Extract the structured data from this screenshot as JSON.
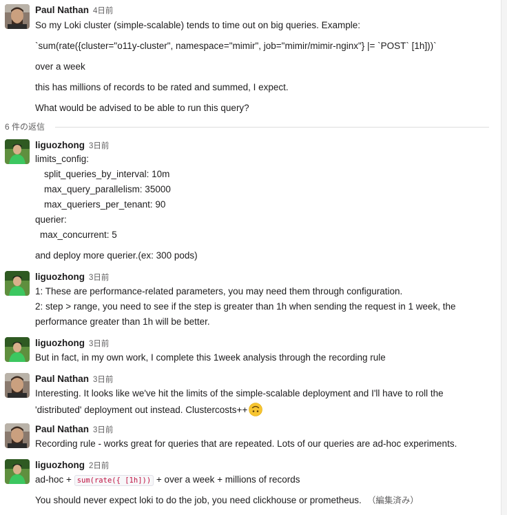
{
  "thread": {
    "reply_count_label": "6 件の返信",
    "messages": [
      {
        "author": "Paul Nathan",
        "time": "4日前",
        "avatar": "paul-avatar",
        "lines": [
          "So my Loki cluster (simple-scalable) tends to time out on big queries. Example:",
          "`sum(rate({cluster=\"o11y-cluster\", namespace=\"mimir\", job=\"mimir/mimir-nginx\"} |= `POST` [1h]))`",
          "over a week",
          "this has millions of records to be rated and summed, I expect.",
          "What would be advised to be able to run this query?"
        ]
      },
      {
        "author": "liguozhong",
        "time": "3日前",
        "avatar": "liguozhong-avatar",
        "lines": [
          "limits_config:",
          "split_queries_by_interval: 10m",
          "max_query_parallelism: 35000",
          "max_queriers_per_tenant: 90",
          "querier:",
          "max_concurrent: 5",
          "and deploy more querier.(ex: 300 pods)"
        ]
      },
      {
        "author": "liguozhong",
        "time": "3日前",
        "avatar": "liguozhong-avatar",
        "lines": [
          "1: These are performance-related parameters, you may need them through configuration.",
          "2: step > range, you need to see if the step is greater than 1h when sending the request in 1 week, the",
          "performance greater than 1h will be better."
        ]
      },
      {
        "author": "liguozhong",
        "time": "3日前",
        "avatar": "liguozhong-avatar",
        "lines": [
          "But in fact, in my own work, I complete this 1week analysis through the recording rule"
        ]
      },
      {
        "author": "Paul Nathan",
        "time": "3日前",
        "avatar": "paul-avatar",
        "lines": [
          "Interesting. It looks like we've hit the limits of the simple-scalable deployment and I'll have to roll the",
          "'distributed' deployment out instead. Clustercosts++"
        ],
        "emoji": "upside-down-face-emoji"
      },
      {
        "author": "Paul Nathan",
        "time": "3日前",
        "avatar": "paul-avatar",
        "lines": [
          "Recording rule - works great for queries that are repeated. Lots of our queries are ad-hoc experiments."
        ]
      },
      {
        "author": "liguozhong",
        "time": "2日前",
        "avatar": "liguozhong-avatar",
        "line1_prefix": "ad-hoc +",
        "line1_code": "sum(rate({  [1h]))",
        "line1_suffix": "+ over a week +   millions of records",
        "line2": "You should never expect loki to do the job, you need clickhouse or prometheus.",
        "edited_label": "（編集済み）"
      }
    ]
  },
  "colors": {
    "text": "#1d1c1d",
    "muted": "#616061",
    "code": "#c01343",
    "divider": "#dddddd"
  }
}
